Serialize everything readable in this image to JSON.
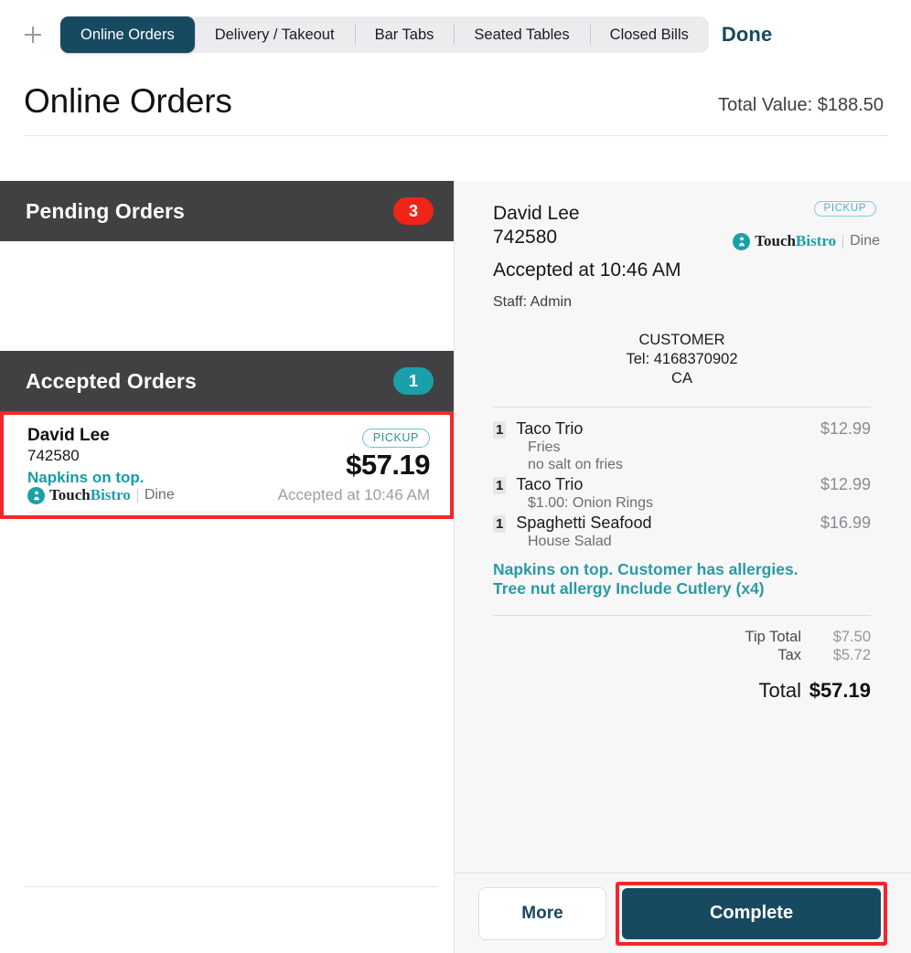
{
  "topbar": {
    "add_icon": "plus-icon",
    "tabs": [
      {
        "label": "Online Orders",
        "active": true
      },
      {
        "label": "Delivery / Takeout",
        "active": false
      },
      {
        "label": "Bar Tabs",
        "active": false
      },
      {
        "label": "Seated Tables",
        "active": false
      },
      {
        "label": "Closed Bills",
        "active": false
      }
    ],
    "done_label": "Done"
  },
  "header": {
    "title": "Online Orders",
    "total_value": "Total Value: $188.50"
  },
  "sidebar": {
    "pending": {
      "title": "Pending Orders",
      "count": "3",
      "badge_color": "#f02419"
    },
    "accepted": {
      "title": "Accepted Orders",
      "count": "1",
      "badge_color": "#1ba0aa"
    },
    "order_card": {
      "customer_name": "David Lee",
      "order_number": "742580",
      "note": "Napkins on top.",
      "tag": "PICKUP",
      "price": "$57.19",
      "accepted_at": "Accepted at 10:46 AM",
      "brand_touch": "Touch",
      "brand_bistro": "Bistro",
      "brand_product": "Dine"
    }
  },
  "detail": {
    "customer_name": "David Lee",
    "order_number": "742580",
    "accepted_at": "Accepted at 10:46 AM",
    "staff": "Staff: Admin",
    "tag": "PICKUP",
    "brand_touch": "Touch",
    "brand_bistro": "Bistro",
    "brand_product": "Dine",
    "customer_block": {
      "heading": "CUSTOMER",
      "tel": "Tel: 4168370902",
      "region": "CA"
    },
    "items": [
      {
        "qty": "1",
        "name": "Taco Trio",
        "price": "$12.99",
        "mods": [
          "Fries",
          "no salt on fries"
        ]
      },
      {
        "qty": "1",
        "name": "Taco Trio",
        "price": "$12.99",
        "mods": [
          "$1.00: Onion Rings"
        ]
      },
      {
        "qty": "1",
        "name": "Spaghetti Seafood",
        "price": "$16.99",
        "mods": [
          "House Salad"
        ]
      }
    ],
    "order_note_line1": "Napkins on top. Customer has allergies.",
    "order_note_line2": "Tree nut allergy Include Cutlery (x4)",
    "totals": {
      "tip_label": "Tip Total",
      "tip_value": "$7.50",
      "tax_label": "Tax",
      "tax_value": "$5.72",
      "total_label": "Total",
      "total_value": "$57.19"
    },
    "footer": {
      "more_label": "More",
      "complete_label": "Complete"
    }
  },
  "colors": {
    "accent_navy": "#174a61",
    "teal": "#1ba0aa",
    "red_badge": "#f02419",
    "highlight_red": "#f3262c",
    "section_gray": "#414143"
  }
}
